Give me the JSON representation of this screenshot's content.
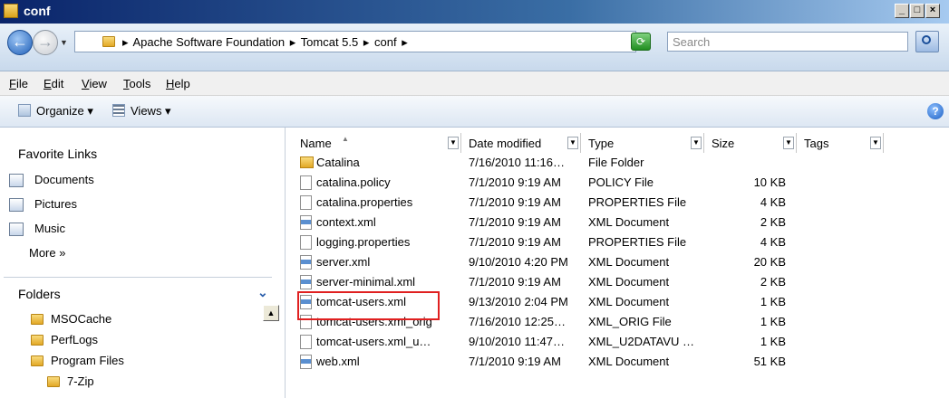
{
  "window": {
    "title": "conf",
    "minimize": "_",
    "maximize": "□",
    "close": "×"
  },
  "address": {
    "crumbs": [
      "Apache Software Foundation",
      "Tomcat 5.5",
      "conf"
    ],
    "separator": "▸",
    "search_placeholder": "Search"
  },
  "menu": [
    "File",
    "Edit",
    "View",
    "Tools",
    "Help"
  ],
  "toolbar": {
    "organize": "Organize ▾",
    "views": "Views ▾",
    "help": "?"
  },
  "nav": {
    "favorites_heading": "Favorite Links",
    "favorites": [
      "Documents",
      "Pictures",
      "Music"
    ],
    "more": "More  »",
    "folders_heading": "Folders",
    "folders": [
      "MSOCache",
      "PerfLogs",
      "Program Files",
      "7-Zip"
    ]
  },
  "columns": {
    "name": "Name",
    "date": "Date modified",
    "type": "Type",
    "size": "Size",
    "tags": "Tags"
  },
  "files": [
    {
      "name": "Catalina",
      "date": "7/16/2010 11:16…",
      "type": "File Folder",
      "size": "",
      "icon": "folder-icon"
    },
    {
      "name": "catalina.policy",
      "date": "7/1/2010 9:19 AM",
      "type": "POLICY File",
      "size": "10 KB",
      "icon": "file-icon"
    },
    {
      "name": "catalina.properties",
      "date": "7/1/2010 9:19 AM",
      "type": "PROPERTIES File",
      "size": "4 KB",
      "icon": "file-icon"
    },
    {
      "name": "context.xml",
      "date": "7/1/2010 9:19 AM",
      "type": "XML Document",
      "size": "2 KB",
      "icon": "xml-file-icon"
    },
    {
      "name": "logging.properties",
      "date": "7/1/2010 9:19 AM",
      "type": "PROPERTIES File",
      "size": "4 KB",
      "icon": "file-icon"
    },
    {
      "name": "server.xml",
      "date": "9/10/2010 4:20 PM",
      "type": "XML Document",
      "size": "20 KB",
      "icon": "xml-file-icon"
    },
    {
      "name": "server-minimal.xml",
      "date": "7/1/2010 9:19 AM",
      "type": "XML Document",
      "size": "2 KB",
      "icon": "xml-file-icon"
    },
    {
      "name": "tomcat-users.xml",
      "date": "9/13/2010 2:04 PM",
      "type": "XML Document",
      "size": "1 KB",
      "icon": "xml-file-icon"
    },
    {
      "name": "tomcat-users.xml_orig",
      "date": "7/16/2010 12:25…",
      "type": "XML_ORIG File",
      "size": "1 KB",
      "icon": "file-icon"
    },
    {
      "name": "tomcat-users.xml_u…",
      "date": "9/10/2010 11:47…",
      "type": "XML_U2DATAVU …",
      "size": "1 KB",
      "icon": "file-icon"
    },
    {
      "name": "web.xml",
      "date": "7/1/2010 9:19 AM",
      "type": "XML Document",
      "size": "51 KB",
      "icon": "xml-file-icon"
    }
  ],
  "colors": {
    "highlight": "#e02020",
    "titlebar": "#0a246a"
  }
}
